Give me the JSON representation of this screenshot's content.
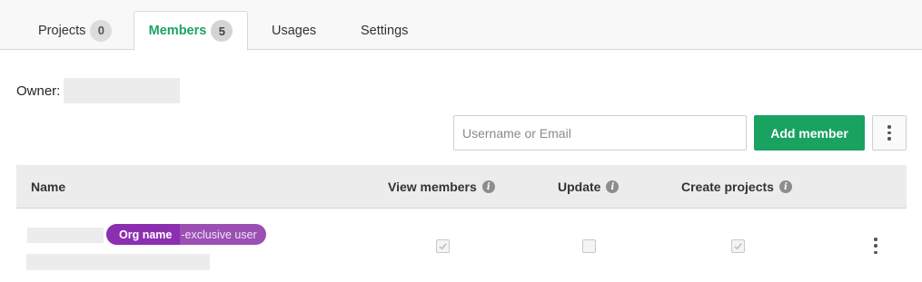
{
  "tabs": [
    {
      "label": "Projects",
      "count": "0",
      "active": false
    },
    {
      "label": "Members",
      "count": "5",
      "active": true
    },
    {
      "label": "Usages",
      "active": false
    },
    {
      "label": "Settings",
      "active": false
    }
  ],
  "owner": {
    "label": "Owner:"
  },
  "toolbar": {
    "search_placeholder": "Username or Email",
    "search_value": "",
    "add_member_label": "Add member",
    "more_icon": "vertical-ellipsis-icon"
  },
  "table": {
    "columns": [
      {
        "label": "Name"
      },
      {
        "label": "View members",
        "icon": "info-icon"
      },
      {
        "label": "Update",
        "icon": "info-icon"
      },
      {
        "label": "Create projects",
        "icon": "info-icon"
      }
    ],
    "rows": [
      {
        "badge_org": "Org name",
        "badge_suffix": "-exclusive user",
        "view_members": true,
        "update": false,
        "create_projects": true,
        "actions_icon": "vertical-ellipsis-icon"
      }
    ]
  },
  "colors": {
    "accent_green": "#1aa260",
    "badge_purple": "#9b4fb3",
    "badge_purple_dark": "#8b2fb0"
  }
}
